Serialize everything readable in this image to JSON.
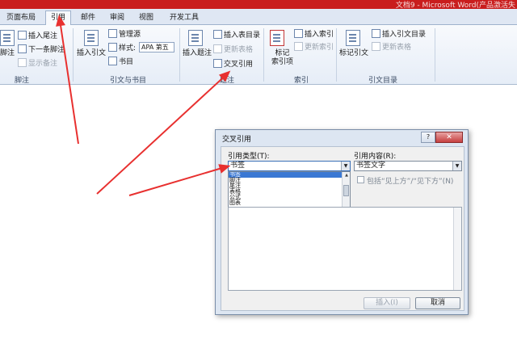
{
  "window": {
    "title": "文档9 - Microsoft Word(产品激活失"
  },
  "tabs": [
    {
      "label": "页面布局"
    },
    {
      "label": "引用",
      "active": true
    },
    {
      "label": "邮件"
    },
    {
      "label": "审阅"
    },
    {
      "label": "视图"
    },
    {
      "label": "开发工具"
    }
  ],
  "ribbon": {
    "footnote_group": {
      "label": "脚注",
      "insert_footnote": "脚注",
      "insert_endnote": "插入尾注",
      "next_footnote": "下一条脚注",
      "show_notes": "显示备注"
    },
    "citation_group": {
      "label": "引文与书目",
      "insert_citation": "插入引文",
      "manage_sources": "管理源",
      "style_label": "样式:",
      "style_value": "APA 第五",
      "bibliography": "书目"
    },
    "caption_group": {
      "label": "题注",
      "insert_caption": "插入题注",
      "insert_table_of_figures": "插入表目录",
      "update_table": "更新表格",
      "cross_reference": "交叉引用"
    },
    "index_group": {
      "label": "索引",
      "mark_entry_line1": "标记",
      "mark_entry_line2": "索引项",
      "insert_index": "插入索引",
      "update_index": "更新索引"
    },
    "toa_group": {
      "label": "引文目录",
      "mark_citation": "标记引文",
      "insert_toa": "插入引文目录",
      "update_table": "更新表格"
    }
  },
  "dialog": {
    "title": "交叉引用",
    "help": "?",
    "close": "✕",
    "reference_type_label": "引用类型(T):",
    "reference_type_value": "书签",
    "reference_type_options": [
      "书签",
      "脚注",
      "尾注",
      "表格",
      "公式",
      "图表"
    ],
    "reference_to_label": "引用内容(R):",
    "reference_to_value": "书签文字",
    "include_above_below": "包括“见上方”/“见下方”(N)",
    "insert_button": "插入(I)",
    "cancel_button": "取消"
  },
  "colors": {
    "arrow": "#e8302f",
    "titlebar": "#c91d1d",
    "selection": "#3a78d4"
  }
}
